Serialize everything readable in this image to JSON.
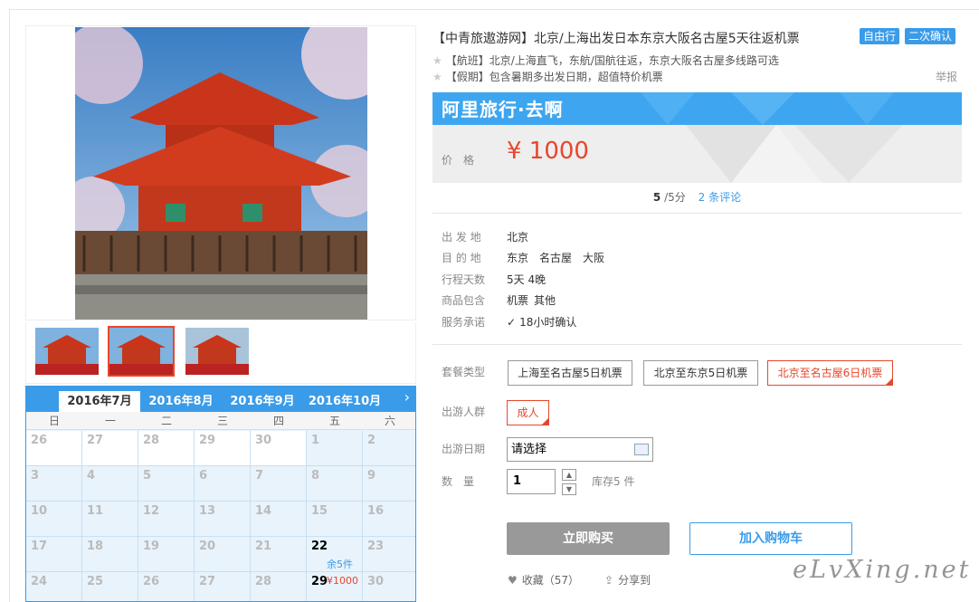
{
  "product": {
    "title": "【中青旅遨游网】北京/上海出发日本东京大阪名古屋5天往返机票",
    "tags": [
      "自由行",
      "二次确认"
    ],
    "subtitles": [
      "【航班】北京/上海直飞，东航/国航往返，东京大阪名古屋多线路可选",
      "【假期】包含暑期多出发日期，超值特价机票"
    ],
    "report": "举报"
  },
  "promo": {
    "brand": "阿里旅行·去啊",
    "price_label": "价格",
    "price": "¥ 1000"
  },
  "rating": {
    "score": "5",
    "scale": "/5分",
    "reviews": "2 条评论"
  },
  "attributes": [
    {
      "label": "出 发 地",
      "values": [
        "北京"
      ]
    },
    {
      "label": "目 的 地",
      "values": [
        "东京",
        "名古屋",
        "大阪"
      ]
    },
    {
      "label": "行程天数",
      "values": [
        "5天 4晚"
      ]
    },
    {
      "label": "商品包含",
      "values": [
        "机票",
        "其他"
      ]
    },
    {
      "label": "服务承诺",
      "values": [
        "18小时确认"
      ]
    }
  ],
  "options": {
    "package_label": "套餐类型",
    "packages": [
      "上海至名古屋5日机票",
      "北京至东京5日机票",
      "北京至名古屋6日机票"
    ],
    "selected_package": 2,
    "people_label": "出游人群",
    "people": "成人",
    "date_label": "出游日期",
    "date_value": "请选择",
    "qty_label": "数　量",
    "qty_value": "1",
    "stock": "库存5 件"
  },
  "actions": {
    "buy": "立即购买",
    "cart": "加入购物车",
    "favorite": "收藏（57）",
    "share": "分享到"
  },
  "calendar": {
    "months": [
      "2016年7月",
      "2016年8月",
      "2016年9月",
      "2016年10月"
    ],
    "active_month": 0,
    "weekdays": [
      "日",
      "一",
      "二",
      "三",
      "四",
      "五",
      "六"
    ],
    "weeks": [
      [
        {
          "d": "26"
        },
        {
          "d": "27"
        },
        {
          "d": "28"
        },
        {
          "d": "29"
        },
        {
          "d": "30"
        },
        {
          "d": "1"
        },
        {
          "d": "2"
        }
      ],
      [
        {
          "d": "3"
        },
        {
          "d": "4"
        },
        {
          "d": "5"
        },
        {
          "d": "6"
        },
        {
          "d": "7"
        },
        {
          "d": "8"
        },
        {
          "d": "9"
        }
      ],
      [
        {
          "d": "10"
        },
        {
          "d": "11"
        },
        {
          "d": "12"
        },
        {
          "d": "13"
        },
        {
          "d": "14"
        },
        {
          "d": "15"
        },
        {
          "d": "16"
        }
      ],
      [
        {
          "d": "17"
        },
        {
          "d": "18"
        },
        {
          "d": "19"
        },
        {
          "d": "20"
        },
        {
          "d": "21"
        },
        {
          "d": "22",
          "stock": "余5件"
        },
        {
          "d": "23"
        }
      ],
      [
        {
          "d": "24"
        },
        {
          "d": "25"
        },
        {
          "d": "26"
        },
        {
          "d": "27"
        },
        {
          "d": "28"
        },
        {
          "d": "29",
          "price": "¥1000"
        },
        {
          "d": "30"
        }
      ]
    ]
  },
  "watermark": "eLvXing.net",
  "colors": {
    "accent": "#3a9be8",
    "price": "#e8462c"
  }
}
